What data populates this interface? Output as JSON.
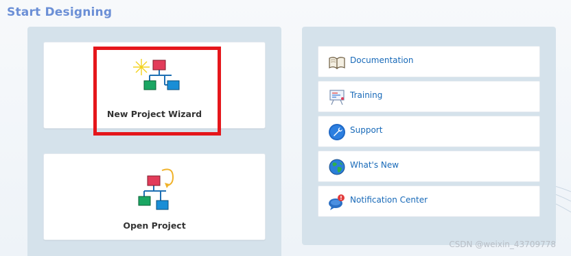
{
  "header": {
    "title": "Start Designing"
  },
  "left_panel": {
    "cards": [
      {
        "label": "New Project Wizard",
        "icon": "new-project-wizard-icon"
      },
      {
        "label": "Open Project",
        "icon": "open-project-icon"
      }
    ]
  },
  "right_panel": {
    "links": [
      {
        "label": "Documentation",
        "icon": "book-icon"
      },
      {
        "label": "Training",
        "icon": "presentation-board-icon"
      },
      {
        "label": "Support",
        "icon": "wrench-icon"
      },
      {
        "label": "What's New",
        "icon": "globe-icon"
      },
      {
        "label": "Notification Center",
        "icon": "chat-bubble-alert-icon"
      }
    ]
  },
  "watermark": "CSDN @weixin_43709778",
  "colors": {
    "title": "#6b8fd6",
    "panel_bg": "#d5e2eb",
    "link_text": "#1769b8",
    "highlight": "#e5161b"
  }
}
